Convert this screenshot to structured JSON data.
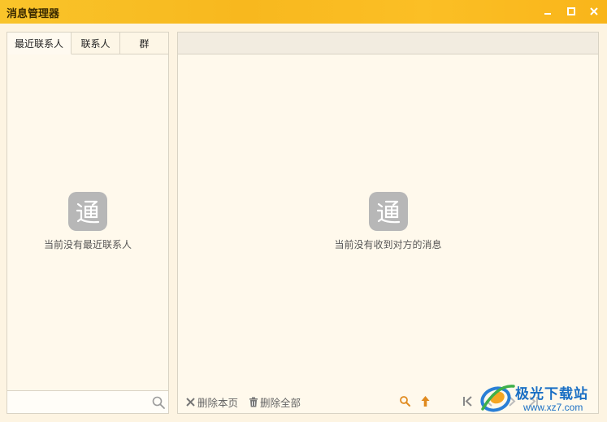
{
  "window": {
    "title": "消息管理器"
  },
  "left_panel": {
    "tabs": [
      {
        "label": "最近联系人"
      },
      {
        "label": "联系人"
      },
      {
        "label": "群"
      }
    ],
    "empty_text": "当前没有最近联系人",
    "search": {
      "placeholder": "",
      "value": ""
    }
  },
  "right_panel": {
    "empty_text": "当前没有收到对方的消息",
    "toolbar": {
      "delete_page_label": "删除本页",
      "delete_all_label": "删除全部"
    }
  },
  "watermark": {
    "title": "极光下载站",
    "url": "www.xz7.com"
  },
  "colors": {
    "titlebar": "#f9c42a",
    "background": "#fdf4e2",
    "panel": "#fff9ec",
    "accent_orange": "#e08a1e",
    "empty_icon": "#b7b7b7",
    "watermark_blue": "#1a6fc4"
  },
  "icons": {
    "window": [
      "minimize-icon",
      "maximize-icon",
      "close-icon"
    ],
    "empty": "tong-logo-icon",
    "toolbar": [
      "x-icon",
      "trash-icon",
      "search-icon",
      "arrow-up-icon",
      "first-page-icon",
      "prev-page-icon",
      "next-page-icon",
      "last-page-icon"
    ]
  }
}
